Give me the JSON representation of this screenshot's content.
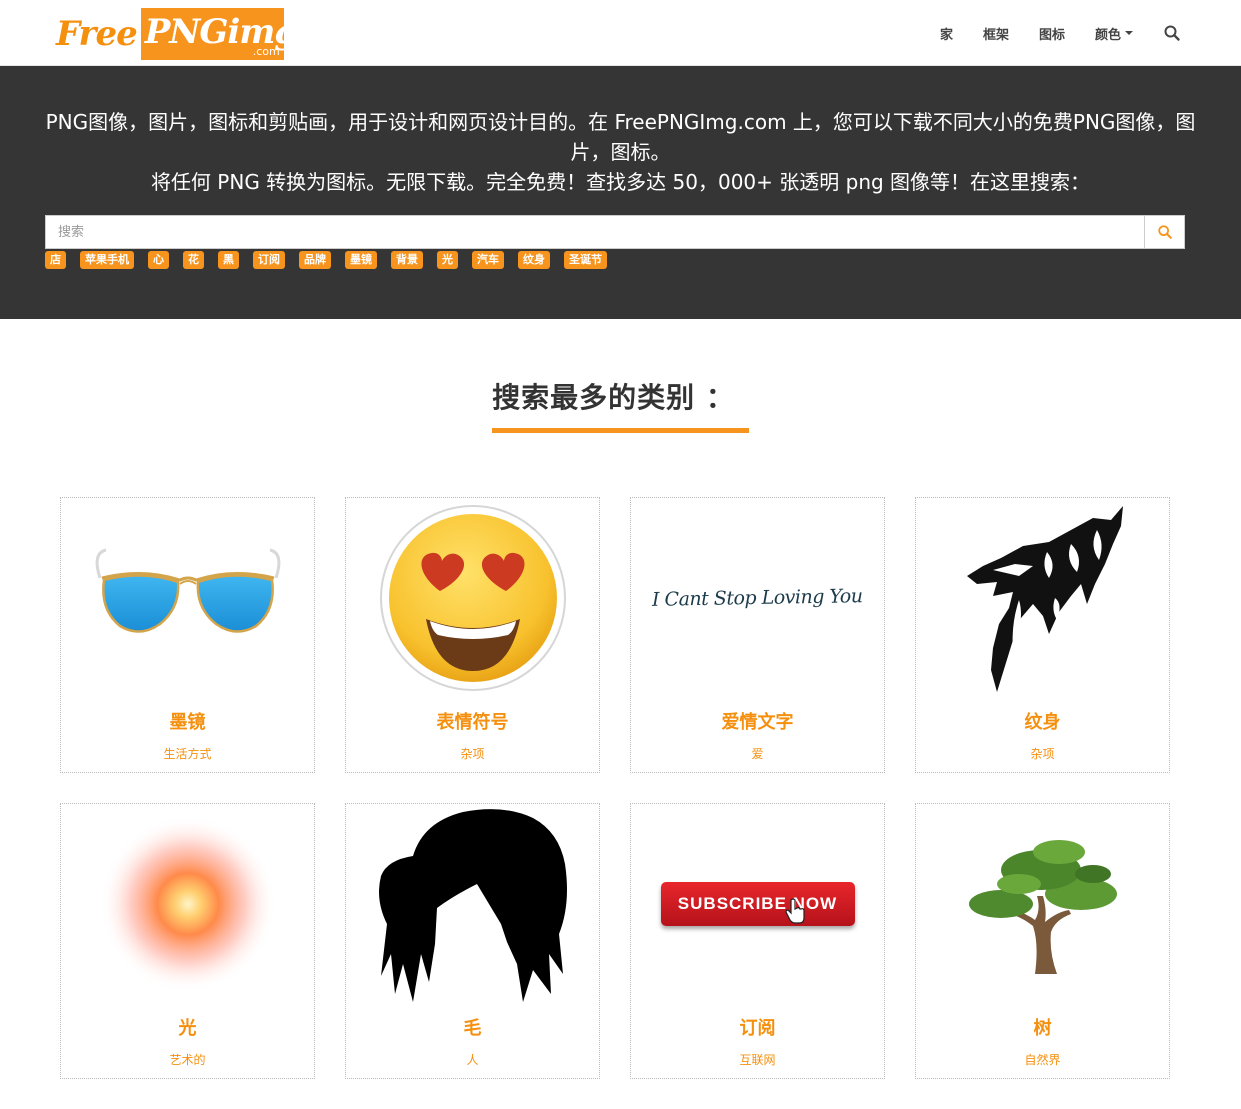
{
  "logo": {
    "free": "Free",
    "png": "PNGimg",
    "com": ".com"
  },
  "nav": {
    "home": "家",
    "frames": "框架",
    "icons": "图标",
    "colors": "颜色"
  },
  "hero": {
    "line1": "PNG图像，图片，图标和剪贴画，用于设计和网页设计目的。在 FreePNGImg.com 上，您可以下载不同大小的免费PNG图像，图片，图标。",
    "line2": "将任何 PNG 转换为图标。无限下载。完全免费！查找多达 50，000+ 张透明 png 图像等！在这里搜索："
  },
  "search": {
    "placeholder": "搜索"
  },
  "tags": [
    "店",
    "苹果手机",
    "心",
    "花",
    "黑",
    "订阅",
    "品牌",
    "墨镜",
    "背景",
    "光",
    "汽车",
    "纹身",
    "圣诞节"
  ],
  "section_title": "搜索最多的类别 ：",
  "cards": [
    {
      "title": "墨镜",
      "sub": "生活方式",
      "image": "sunglasses"
    },
    {
      "title": "表情符号",
      "sub": "杂项",
      "image": "heart-eyes-emoji"
    },
    {
      "title": "爱情文字",
      "sub": "爱",
      "image": "love-text",
      "image_text": "I Cant Stop Loving You"
    },
    {
      "title": "纹身",
      "sub": "杂项",
      "image": "wolf-tattoo"
    },
    {
      "title": "光",
      "sub": "艺术的",
      "image": "light-glow"
    },
    {
      "title": "毛",
      "sub": "人",
      "image": "hair"
    },
    {
      "title": "订阅",
      "sub": "互联网",
      "image": "subscribe-button",
      "image_text": "SUBSCRIBE NOW"
    },
    {
      "title": "树",
      "sub": "自然界",
      "image": "tree"
    }
  ],
  "colors": {
    "accent": "#f7941d",
    "hero_bg": "#353535"
  }
}
